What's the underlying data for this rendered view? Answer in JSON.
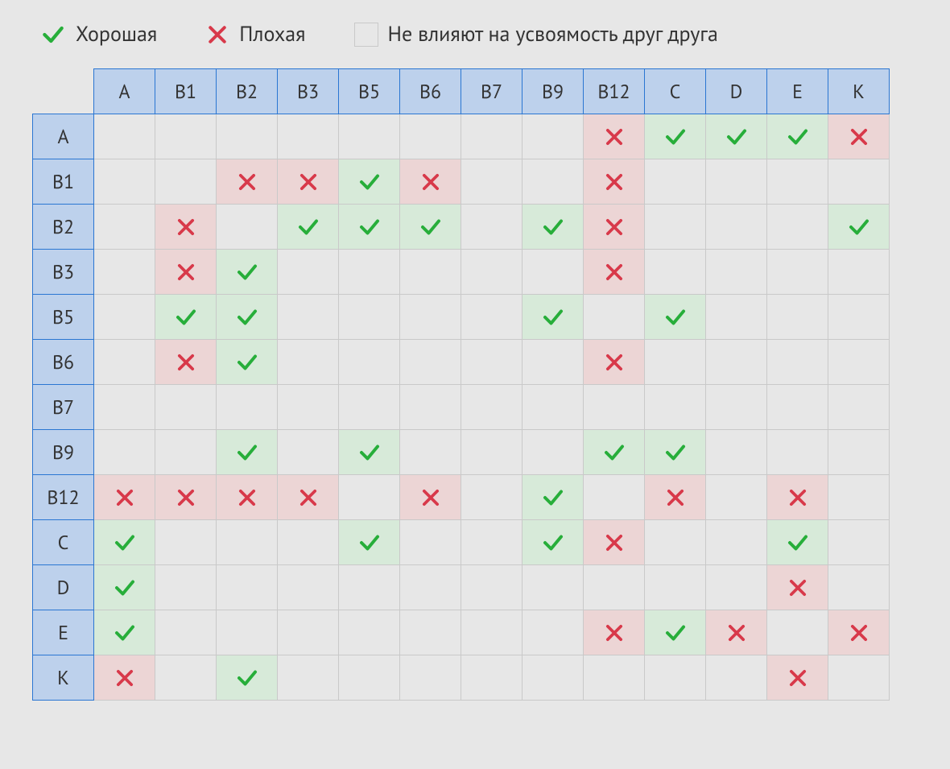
{
  "legend": {
    "good": "Хорошая",
    "bad": "Плохая",
    "neutral": "Не влияют на усвоямость друг друга"
  },
  "chart_data": {
    "type": "heatmap",
    "title": "",
    "categories": [
      "A",
      "B1",
      "B2",
      "B3",
      "B5",
      "B6",
      "B7",
      "B9",
      "B12",
      "C",
      "D",
      "E",
      "K"
    ],
    "legend_values": {
      "good": "Хорошая",
      "bad": "Плохая",
      "neutral": "Не влияют на усвоямость друг друга"
    },
    "matrix": [
      [
        "",
        "",
        "",
        "",
        "",
        "",
        "",
        "",
        "bad",
        "good",
        "good",
        "good",
        "bad"
      ],
      [
        "",
        "",
        "bad",
        "bad",
        "good",
        "bad",
        "",
        "",
        "bad",
        "",
        "",
        "",
        ""
      ],
      [
        "",
        "bad",
        "",
        "good",
        "good",
        "good",
        "",
        "good",
        "bad",
        "",
        "",
        "",
        "good"
      ],
      [
        "",
        "bad",
        "good",
        "",
        "",
        "",
        "",
        "",
        "bad",
        "",
        "",
        "",
        ""
      ],
      [
        "",
        "good",
        "good",
        "",
        "",
        "",
        "",
        "good",
        "",
        "good",
        "",
        "",
        ""
      ],
      [
        "",
        "bad",
        "good",
        "",
        "",
        "",
        "",
        "",
        "bad",
        "",
        "",
        "",
        ""
      ],
      [
        "",
        "",
        "",
        "",
        "",
        "",
        "",
        "",
        "",
        "",
        "",
        "",
        ""
      ],
      [
        "",
        "",
        "good",
        "",
        "good",
        "",
        "",
        "",
        "good",
        "good",
        "",
        "",
        ""
      ],
      [
        "bad",
        "bad",
        "bad",
        "bad",
        "",
        "bad",
        "",
        "good",
        "",
        "bad",
        "",
        "bad",
        ""
      ],
      [
        "good",
        "",
        "",
        "",
        "good",
        "",
        "",
        "good",
        "bad",
        "",
        "",
        "good",
        ""
      ],
      [
        "good",
        "",
        "",
        "",
        "",
        "",
        "",
        "",
        "",
        "",
        "",
        "bad",
        ""
      ],
      [
        "good",
        "",
        "",
        "",
        "",
        "",
        "",
        "",
        "bad",
        "good",
        "bad",
        "",
        "bad"
      ],
      [
        "bad",
        "",
        "good",
        "",
        "",
        "",
        "",
        "",
        "",
        "",
        "",
        "bad",
        ""
      ]
    ]
  }
}
